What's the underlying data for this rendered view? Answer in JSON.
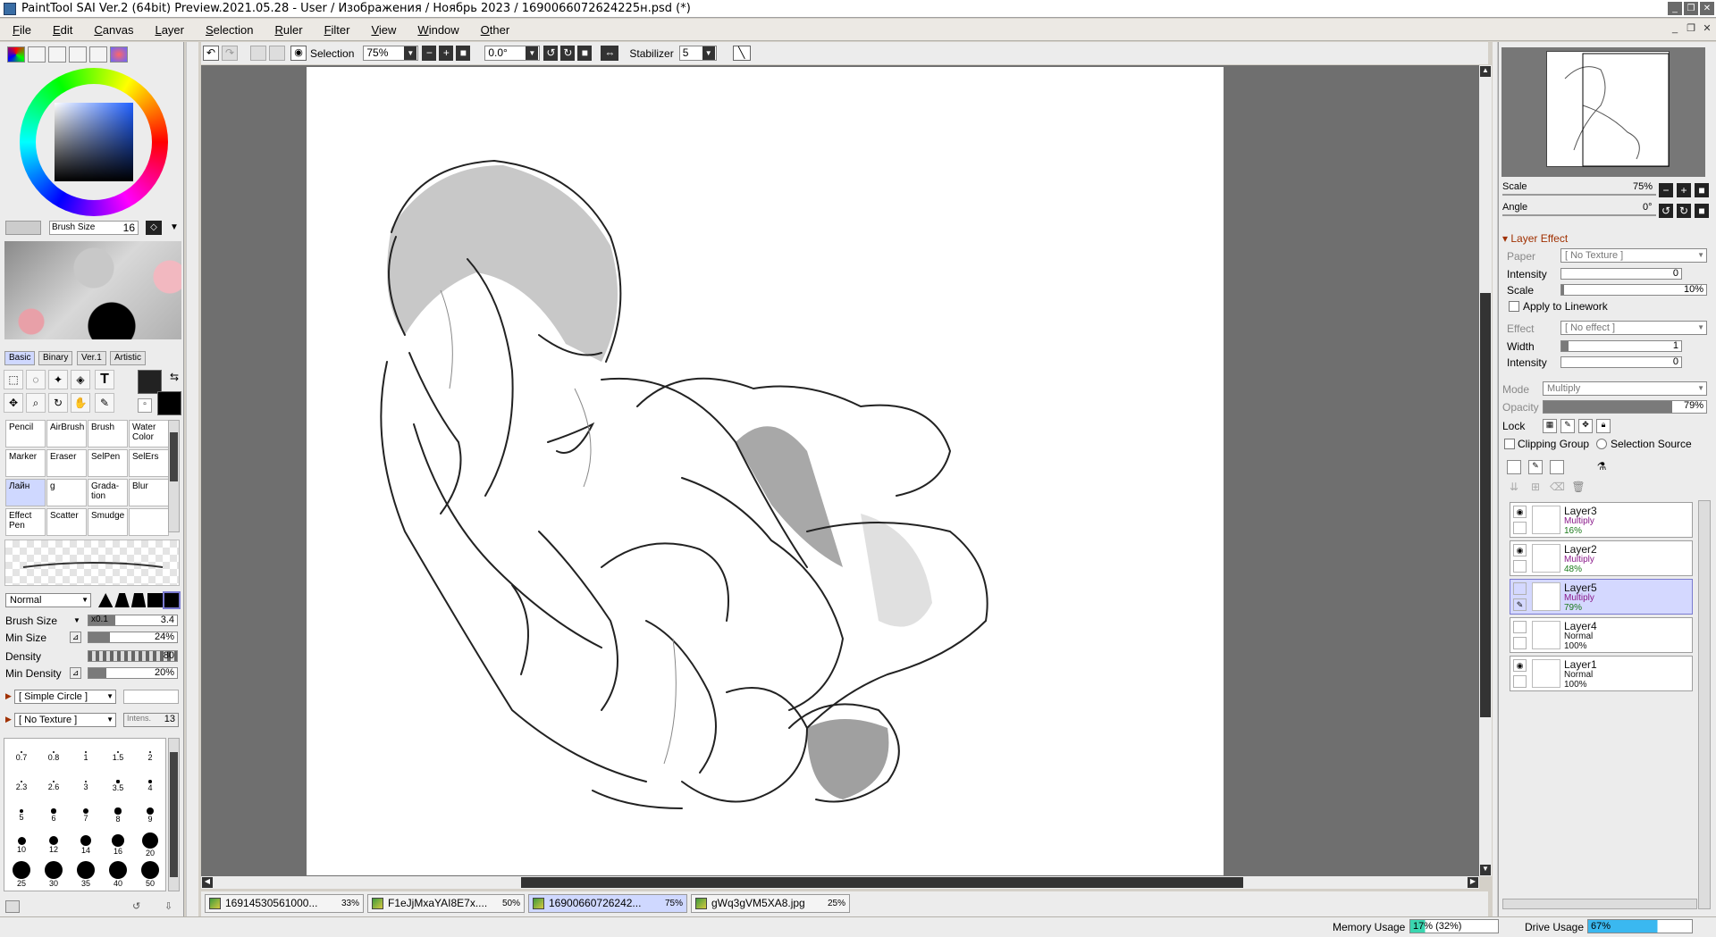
{
  "window": {
    "title": "PaintTool SAI Ver.2 (64bit) Preview.2021.05.28 - User / Изображения / Ноябрь 2023 / 1690066072624225н.psd (*)",
    "min": "_",
    "restore": "❐",
    "close": "✕"
  },
  "menu": [
    "File",
    "Edit",
    "Canvas",
    "Layer",
    "Selection",
    "Ruler",
    "Filter",
    "View",
    "Window",
    "Other"
  ],
  "toolbar": {
    "selection_label": "Selection",
    "zoom": "75%",
    "angle": "0.0°",
    "stabilizer_label": "Stabilizer",
    "stabilizer_value": "5"
  },
  "left": {
    "brush_size_label": "Brush Size",
    "brush_size_value": "16",
    "tabs": [
      "Basic",
      "Binary",
      "Ver.1",
      "Artistic"
    ],
    "brushes": [
      {
        "label": "Pencil"
      },
      {
        "label": "AirBrush"
      },
      {
        "label": "Brush"
      },
      {
        "label": "Water Color"
      },
      {
        "label": "Marker"
      },
      {
        "label": "Eraser"
      },
      {
        "label": "SelPen"
      },
      {
        "label": "SelErs"
      },
      {
        "label": "Лайн"
      },
      {
        "label": "g"
      },
      {
        "label": "Grada-tion"
      },
      {
        "label": "Blur"
      },
      {
        "label": "Effect Pen"
      },
      {
        "label": "Scatter"
      },
      {
        "label": "Smudge"
      },
      {
        "label": ""
      }
    ],
    "blend_mode": "Normal",
    "props": {
      "brush_size_label": "Brush Size",
      "brush_size_mult": "x0.1",
      "brush_size_value": "3.4",
      "brush_size_fill": 0.3,
      "min_size_label": "Min Size",
      "min_size_value": "24%",
      "min_size_fill": 0.24,
      "density_label": "Density",
      "density_value": "80",
      "density_fill": 0.8,
      "min_density_label": "Min Density",
      "min_density_value": "20%",
      "min_density_fill": 0.2
    },
    "shape": "[ Simple Circle ]",
    "texture": "[ No Texture ]",
    "texture_intens_label": "Intens.",
    "texture_intens_value": "13",
    "dots": [
      "0.7",
      "0.8",
      "1",
      "1.5",
      "2",
      "2.3",
      "2.6",
      "3",
      "3.5",
      "4",
      "5",
      "6",
      "7",
      "8",
      "9",
      "10",
      "12",
      "14",
      "16",
      "20",
      "25",
      "30",
      "35",
      "40",
      "50"
    ]
  },
  "doc_tabs": [
    {
      "name": "16914530561000...",
      "zoom": "33%"
    },
    {
      "name": "F1eJjMxaYAI8E7x....",
      "zoom": "50%"
    },
    {
      "name": "16900660726242...",
      "zoom": "75%"
    },
    {
      "name": "gWq3gVM5XA8.jpg",
      "zoom": "25%"
    }
  ],
  "right": {
    "scale_label": "Scale",
    "scale_value": "75%",
    "angle_label": "Angle",
    "angle_value": "0°",
    "layer_effect_title": "Layer Effect",
    "paper_label": "Paper",
    "paper_value": "[ No Texture ]",
    "intensity_label": "Intensity",
    "intensity_value": "0",
    "scale2_label": "Scale",
    "scale2_value": "10%",
    "apply_linework_label": "Apply to Linework",
    "effect_label": "Effect",
    "effect_value": "[ No effect ]",
    "width_label": "Width",
    "width_value": "1",
    "intensity2_label": "Intensity",
    "intensity2_value": "0",
    "mode_label": "Mode",
    "mode_value": "Multiply",
    "opacity_label": "Opacity",
    "opacity_value": "79%",
    "opacity_fill": 0.79,
    "lock_label": "Lock",
    "clipping_label": "Clipping Group",
    "selsource_label": "Selection Source",
    "layers": [
      {
        "name": "Layer3",
        "mode": "Multiply",
        "opacity": "16%",
        "visible": true
      },
      {
        "name": "Layer2",
        "mode": "Multiply",
        "opacity": "48%",
        "visible": true
      },
      {
        "name": "Layer5",
        "mode": "Multiply",
        "opacity": "79%",
        "visible": false
      },
      {
        "name": "Layer4",
        "mode": "Normal",
        "opacity": "100%",
        "visible": false
      },
      {
        "name": "Layer1",
        "mode": "Normal",
        "opacity": "100%",
        "visible": true
      }
    ]
  },
  "status": {
    "memory_label": "Memory Usage",
    "memory_value": "17% (32%)",
    "drive_label": "Drive Usage",
    "drive_value": "67%"
  }
}
